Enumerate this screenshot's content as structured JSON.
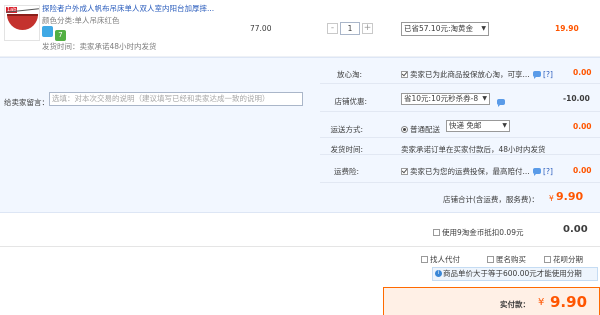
{
  "product": {
    "title": "探险者户外成人帆布吊床单人双人室内阳台加厚摔...",
    "spec": "颜色分类:单人吊床红色",
    "badges": [
      "",
      "7"
    ],
    "shipping": "发货时间：卖家承诺48小时内发货",
    "unit_price": "77.00",
    "quantity": "1",
    "qty_minus": "-",
    "qty_plus": "+",
    "promotion": "已省57.10元:淘黄金",
    "subtotal": "19.90",
    "image_tag": "1ab"
  },
  "message": {
    "label": "给卖家留言：",
    "placeholder": "选填：对本次交易的说明（建议填写已经和卖家达成一致的说明）"
  },
  "rows": {
    "worry_free": {
      "label": "放心淘:",
      "text": "卖家已为此商品投保放心淘，可享...",
      "help": "[?]",
      "value": "0.00"
    },
    "store_discount": {
      "label": "店铺优惠:",
      "selected": "省10元:10元秒杀券-8",
      "value": "-10.00"
    },
    "delivery": {
      "label": "运送方式:",
      "option": "普通配送",
      "selected": "快递 免邮",
      "value": "0.00"
    },
    "ship_time": {
      "label": "发货时间:",
      "text": "卖家承诺订单在买家付款后，48小时内发货"
    },
    "freight_insurance": {
      "label": "运费险:",
      "text": "卖家已为您的运费投保，最高赔付...",
      "help": "[?]",
      "value": "0.00"
    }
  },
  "total": {
    "label": "店铺合计(含运费，服务费)：",
    "currency": "¥",
    "value": "9.90"
  },
  "coins": {
    "label": "使用9淘金币抵扣0.09元",
    "value": "0.00"
  },
  "options": [
    {
      "label": "找人代付"
    },
    {
      "label": "匿名购买"
    },
    {
      "label": "花呗分期"
    }
  ],
  "notice": {
    "text": "商品单价大于等于600.00元才能使用分期"
  },
  "final": {
    "label": "实付款：",
    "currency": "¥",
    "value": "9.90"
  },
  "colors": {
    "accent": "#ff5500",
    "link": "#2a5cbc",
    "panel": "#f2f7ff"
  }
}
